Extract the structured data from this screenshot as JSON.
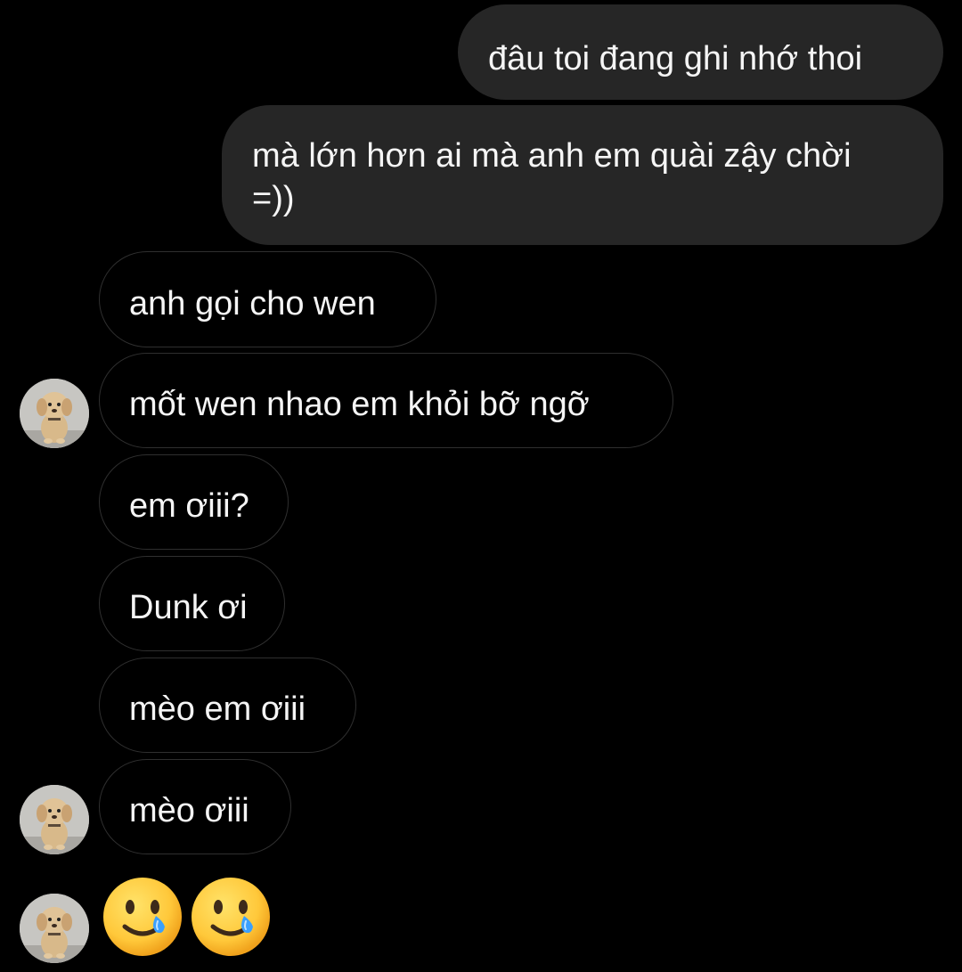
{
  "conversation": {
    "messages": [
      {
        "direction": "outgoing",
        "text": "đâu toi đang ghi nhớ thoi"
      },
      {
        "direction": "outgoing",
        "text": "mà lớn hơn ai mà anh em quài zậy chời =))"
      },
      {
        "direction": "incoming",
        "text": "anh gọi cho wen"
      },
      {
        "direction": "incoming",
        "text": "mốt wen nhao em khỏi bỡ ngỡ"
      },
      {
        "direction": "incoming",
        "text": "em ơiii?"
      },
      {
        "direction": "incoming",
        "text": "Dunk ơi"
      },
      {
        "direction": "incoming",
        "text": "mèo em ơiii"
      },
      {
        "direction": "incoming",
        "text": "mèo ơiii"
      }
    ],
    "emoji_message": [
      "smiling-face-with-tear-emoji",
      "smiling-face-with-tear-emoji"
    ]
  },
  "theme": {
    "background": "#000000",
    "outgoing_bubble": "#262626",
    "incoming_border": "#2f2f2f",
    "text": "#f5f5f5"
  },
  "avatar": {
    "icon": "puppy-avatar-icon"
  }
}
